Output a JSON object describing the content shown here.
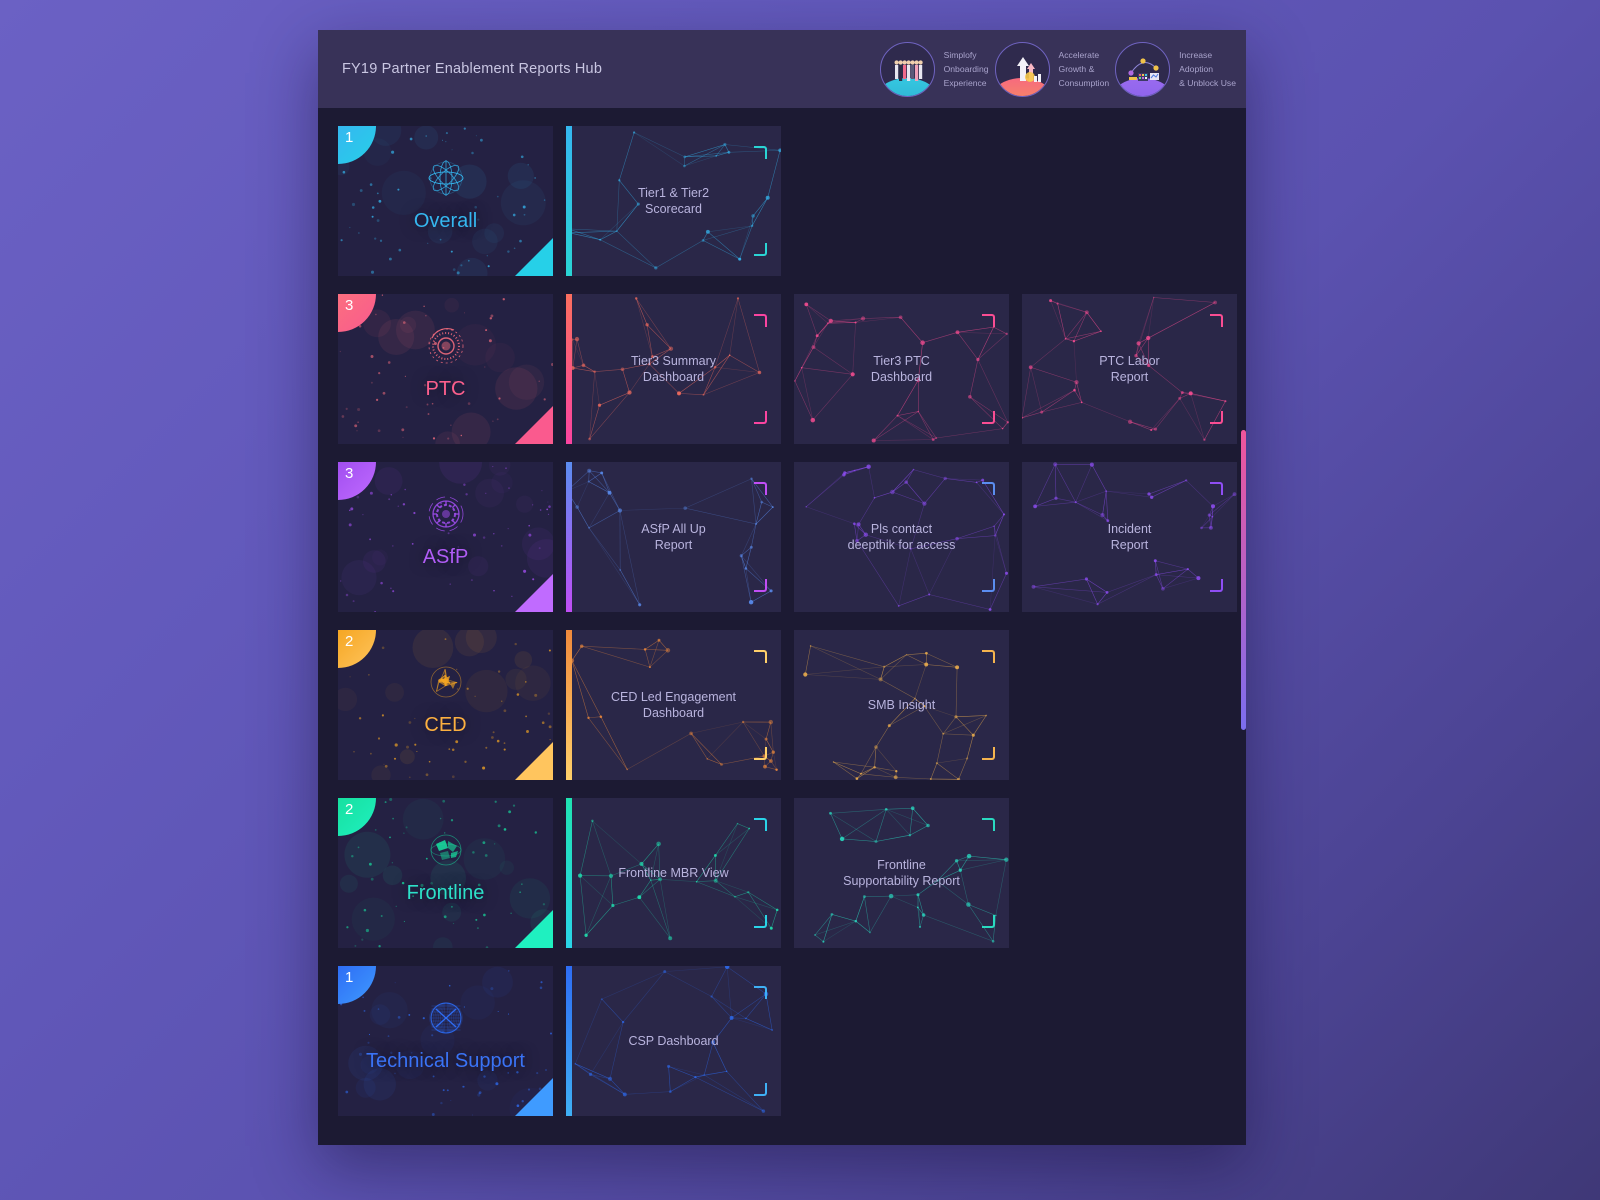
{
  "header": {
    "title": "FY19 Partner Enablement Reports Hub",
    "pillars": [
      {
        "id": "simplify-onboarding",
        "icon": "people-group-icon",
        "lines": [
          "Simplofy",
          "Onboarding",
          "Experience"
        ],
        "color": "#35c7e0"
      },
      {
        "id": "accelerate-growth",
        "icon": "growth-arrow-icon",
        "lines": [
          "Accelerate",
          "Growth &",
          "Consumption"
        ],
        "color": "#f76a7f"
      },
      {
        "id": "increase-adoption",
        "icon": "adoption-network-icon",
        "lines": [
          "Increase",
          "Adoption",
          "& Unblock Use"
        ],
        "color": "#9a6bef"
      }
    ]
  },
  "scrollbar": {
    "colors": [
      "#f0559b",
      "#7b6ef0"
    ]
  },
  "rows": [
    {
      "category": {
        "name": "overall",
        "label": "Overall",
        "count": "1",
        "icon": "atom-sphere-icon",
        "color": "#35b7f0",
        "color_end": "#26d0e8",
        "label_color": "#35b7f0"
      },
      "reports": [
        {
          "name": "tier1-tier2-scorecard",
          "title": "Tier1 & Tier2\nScorecard",
          "accent": "#35b7f0",
          "accent_end": "#2ad4d4"
        }
      ]
    },
    {
      "category": {
        "name": "ptc",
        "label": "PTC",
        "count": "3",
        "icon": "radial-dial-icon",
        "color": "#fb6f7f",
        "color_end": "#fa5a8e",
        "label_color": "#fb5f8c"
      },
      "reports": [
        {
          "name": "tier3-summary-dashboard",
          "title": "Tier3 Summary\nDashboard",
          "accent": "#fb6f5f",
          "accent_end": "#fa44a0"
        },
        {
          "name": "tier3-ptc-dashboard",
          "title": "Tier3 PTC\nDashboard",
          "accent": "#fa4d93",
          "accent_end": "#fa4d93"
        },
        {
          "name": "ptc-labor-report",
          "title": "PTC Labor\nReport",
          "accent": "#fa4d93",
          "accent_end": "#fa4d93"
        }
      ]
    },
    {
      "category": {
        "name": "asfp",
        "label": "ASfP",
        "count": "3",
        "icon": "gear-orbit-icon",
        "color": "#a14ef0",
        "color_end": "#c06bff",
        "label_color": "#b05cf5"
      },
      "reports": [
        {
          "name": "asfp-all-up-report",
          "title": "ASfP All Up\nReport",
          "accent": "#5b8df0",
          "accent_end": "#c14ef5"
        },
        {
          "name": "pls-contact-deepthik",
          "title": "Pls contact\ndeepthik for access",
          "accent": "#8f4ef5",
          "accent_end": "#5b8df0"
        },
        {
          "name": "incident-report",
          "title": "Incident\nReport",
          "accent": "#8f4ef5",
          "accent_end": "#8f4ef5"
        }
      ]
    },
    {
      "category": {
        "name": "ced",
        "label": "CED",
        "count": "2",
        "icon": "globe-wire-icon",
        "color": "#f5a623",
        "color_end": "#ffc55e",
        "label_color": "#fcb040"
      },
      "reports": [
        {
          "name": "ced-led-engagement-dashboard",
          "title": "CED Led Engagement\nDashboard",
          "accent": "#f08a3c",
          "accent_end": "#ffd06a"
        },
        {
          "name": "smb-insight",
          "title": "SMB Insight",
          "accent": "#f5b44e",
          "accent_end": "#f5b44e"
        }
      ]
    },
    {
      "category": {
        "name": "frontline",
        "label": "Frontline",
        "count": "2",
        "icon": "globe-facet-icon",
        "color": "#17e0a0",
        "color_end": "#1ff0c0",
        "label_color": "#2de0c8"
      },
      "reports": [
        {
          "name": "frontline-mbr-view",
          "title": "Frontline MBR View",
          "accent": "#20e3b2",
          "accent_end": "#2ad4e8"
        },
        {
          "name": "frontline-supportability-report",
          "title": "Frontline\nSupportability Report",
          "accent": "#2ad9c0",
          "accent_end": "#2ad9c0"
        }
      ]
    },
    {
      "category": {
        "name": "technical-support",
        "label": "Technical Support",
        "count": "1",
        "icon": "sphere-grid-icon",
        "color": "#2e6df5",
        "color_end": "#3f9bff",
        "label_color": "#3a73f5"
      },
      "reports": [
        {
          "name": "csp-dashboard",
          "title": "CSP Dashboard",
          "accent": "#2e6df5",
          "accent_end": "#3fb0f5"
        }
      ]
    }
  ]
}
